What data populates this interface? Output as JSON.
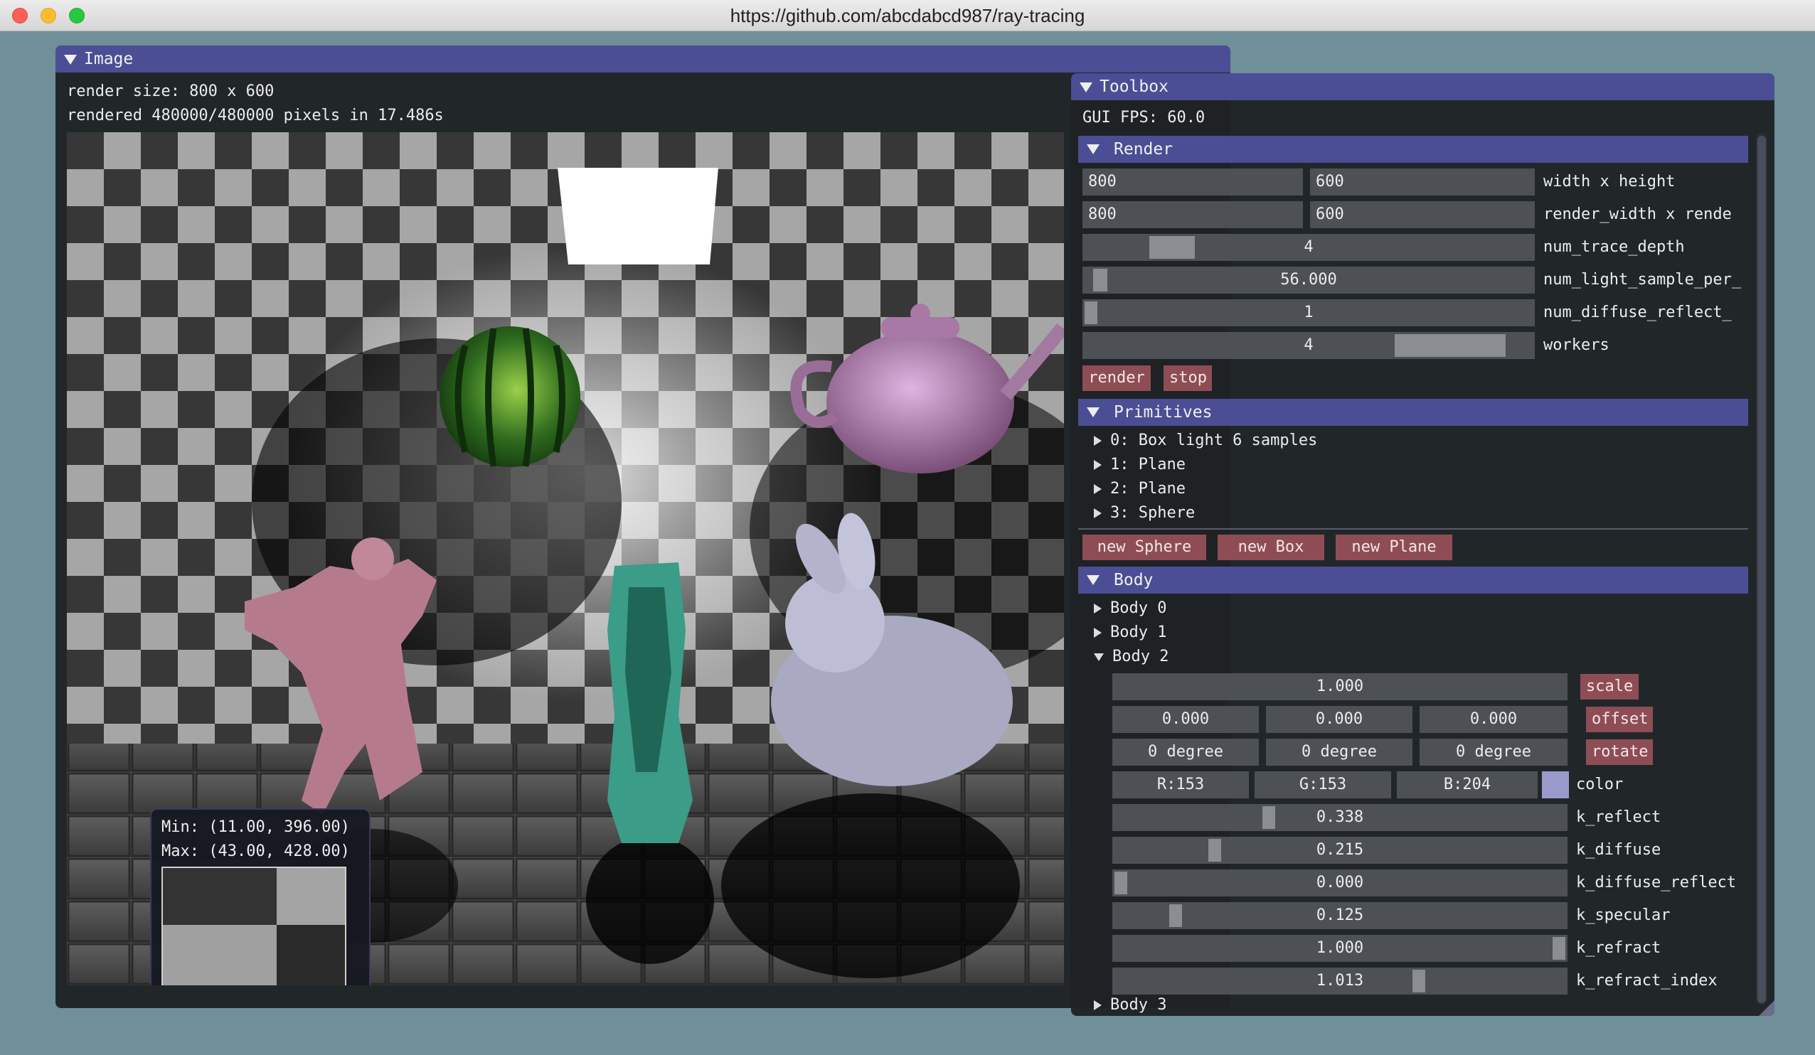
{
  "window": {
    "title": "https://github.com/abcdabcd987/ray-tracing"
  },
  "image_panel": {
    "title": "Image",
    "render_size": "render size: 800 x 600",
    "rendered": "rendered 480000/480000 pixels in 17.486s",
    "zoom": {
      "min": "Min: (11.00, 396.00)",
      "max": "Max: (43.00, 428.00)"
    }
  },
  "toolbox": {
    "title": "Toolbox",
    "fps": "GUI FPS: 60.0",
    "render": {
      "header": "Render",
      "width": "800",
      "height": "600",
      "size_label": "width x height",
      "render_width": "800",
      "render_height": "600",
      "render_size_label": "render_width x rende",
      "trace_depth": "4",
      "trace_depth_label": "num_trace_depth",
      "trace_depth_level": 0.16,
      "light_sample": "56.000",
      "light_sample_label": "num_light_sample_per_",
      "light_sample_level": 0.02,
      "diffuse_reflect": "1",
      "diffuse_reflect_label": "num_diffuse_reflect_",
      "diffuse_reflect_level": 0.0,
      "workers": "4",
      "workers_label": "workers",
      "workers_level": 0.92,
      "render_button": "render",
      "stop_button": "stop"
    },
    "primitives": {
      "header": "Primitives",
      "items": [
        "0: Box light 6 samples",
        "1: Plane",
        "2: Plane",
        "3: Sphere"
      ],
      "new_sphere": "new Sphere",
      "new_box": "new Box",
      "new_plane": "new Plane"
    },
    "body": {
      "header": "Body",
      "items": [
        "Body 0",
        "Body 1",
        "Body 2",
        "Body 3"
      ],
      "scale": "1.000",
      "scale_button": "scale",
      "offset": [
        "0.000",
        "0.000",
        "0.000"
      ],
      "offset_button": "offset",
      "rotate": [
        "0 degree",
        "0 degree",
        "0 degree"
      ],
      "rotate_button": "rotate",
      "color": {
        "r": "R:153",
        "g": "G:153",
        "b": "B:204",
        "label": "color",
        "swatch": "#9999cc"
      },
      "k_reflect": "0.338",
      "k_reflect_label": "k_reflect",
      "k_reflect_level": 0.338,
      "k_diffuse": "0.215",
      "k_diffuse_label": "k_diffuse",
      "k_diffuse_level": 0.215,
      "k_diffuse_reflect": "0.000",
      "k_diffuse_reflect_label": "k_diffuse_reflect",
      "k_diffuse_reflect_level": 0.0,
      "k_specular": "0.125",
      "k_specular_label": "k_specular",
      "k_specular_level": 0.125,
      "k_refract": "1.000",
      "k_refract_label": "k_refract",
      "k_refract_level": 1.0,
      "k_refract_index": "1.013",
      "k_refract_index_label": "k_refract_index",
      "k_refract_index_level": 0.68
    }
  }
}
